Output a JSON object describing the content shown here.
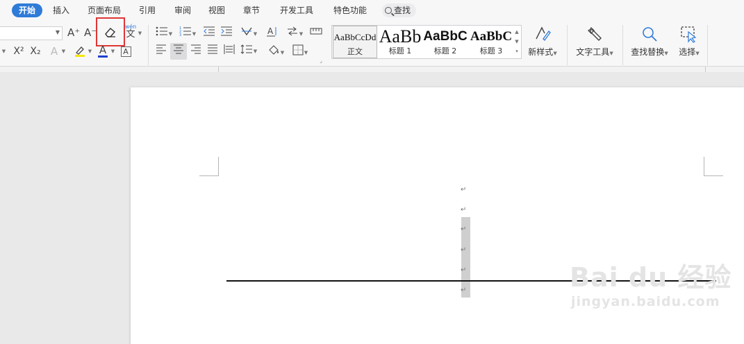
{
  "tabs": [
    "开始",
    "插入",
    "页面布局",
    "引用",
    "审阅",
    "视图",
    "章节",
    "开发工具",
    "特色功能",
    "查找"
  ],
  "font_tools": {
    "grow": "A⁺",
    "shrink": "A⁻",
    "phonetic_sup": "wén",
    "phonetic": "文",
    "superscript": "X²",
    "subscript": "X₂",
    "text_effect": "A",
    "font_color": "A",
    "char_border": "A"
  },
  "styles": [
    {
      "sample": "AaBbCcDd",
      "name": "正文"
    },
    {
      "sample": "AaBb",
      "name": "标题 1"
    },
    {
      "sample": "AaBbC",
      "name": "标题 2"
    },
    {
      "sample": "AaBbC",
      "name": "标题 3"
    }
  ],
  "big_buttons": {
    "new_style": "新样式",
    "text_tools": "文字工具",
    "find_replace": "查找替换",
    "select": "选择"
  },
  "paragraph_mark": "↵",
  "watermark": {
    "logo": "Bai du 经验",
    "url": "jingyan.baidu.com"
  },
  "colors": {
    "accent": "#2f7bd8",
    "highlight_box": "#e03535",
    "font_color_bar": "#1f3fd0",
    "highlighter_bar": "#f7e600"
  }
}
